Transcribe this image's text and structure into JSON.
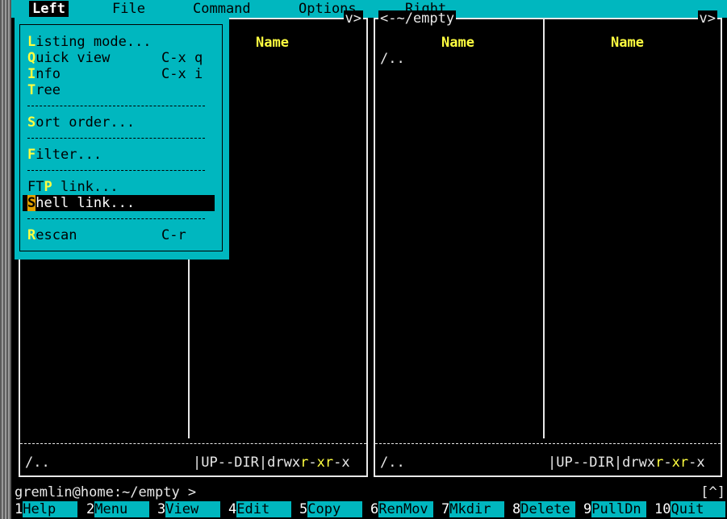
{
  "menubar": {
    "items": [
      "Left",
      "File",
      "Command",
      "Options",
      "Right"
    ]
  },
  "left_panel": {
    "chevron": "v>",
    "column_header": "Name",
    "status_name": "/..",
    "status_info": "UP--DIR",
    "perm_prefix": "drwx",
    "perm_r1": "r",
    "perm_dash1": "-",
    "perm_x1": "x",
    "perm_r2": "r",
    "perm_tail": "-x"
  },
  "right_panel": {
    "path": "<-~/empty",
    "chevron": "v>",
    "col1_header": "Name",
    "col2_header": "Name",
    "entry": "/..",
    "status_name": "/..",
    "status_info": "UP--DIR",
    "perm_prefix": "drwx",
    "perm_r1": "r",
    "perm_dash1": "-",
    "perm_x1": "x",
    "perm_r2": "r",
    "perm_tail": "-x"
  },
  "dropdown": {
    "items": [
      {
        "hot": "L",
        "rest": "isting mode...",
        "shortcut": ""
      },
      {
        "hot": "Q",
        "rest": "uick view",
        "shortcut": "C-x q"
      },
      {
        "hot": "I",
        "rest": "nfo",
        "shortcut": "C-x i"
      },
      {
        "hot": "T",
        "rest": "ree",
        "shortcut": ""
      },
      {
        "hot": "S",
        "rest": "ort order...",
        "shortcut": ""
      },
      {
        "hot": "F",
        "rest": "ilter...",
        "shortcut": ""
      },
      {
        "pre": "FT",
        "hot": "P",
        "rest": " link...",
        "shortcut": ""
      },
      {
        "hot": "S",
        "rest": "hell link...",
        "shortcut": ""
      },
      {
        "hot": "R",
        "rest": "escan",
        "shortcut": "C-r"
      }
    ]
  },
  "prompt": "gremlin@home:~/empty >",
  "scroll_indicator": "[^]",
  "fkeys": [
    {
      "num": "1",
      "label": "Help"
    },
    {
      "num": "2",
      "label": "Menu"
    },
    {
      "num": "3",
      "label": "View"
    },
    {
      "num": "4",
      "label": "Edit"
    },
    {
      "num": "5",
      "label": "Copy"
    },
    {
      "num": "6",
      "label": "RenMov"
    },
    {
      "num": "7",
      "label": "Mkdir"
    },
    {
      "num": "8",
      "label": "Delete"
    },
    {
      "num": "9",
      "label": "PullDn"
    },
    {
      "num": "10",
      "label": "Quit"
    }
  ]
}
